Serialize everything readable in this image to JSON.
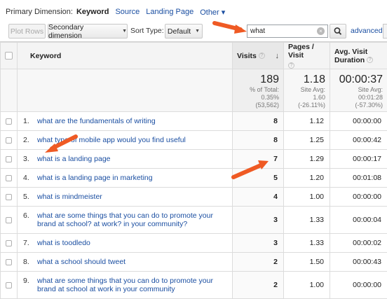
{
  "primary": {
    "label": "Primary Dimension:",
    "active": "Keyword",
    "links": [
      "Source",
      "Landing Page"
    ],
    "other": "Other ▾"
  },
  "toolbar": {
    "plot_rows": "Plot Rows",
    "secondary_dimension": "Secondary dimension",
    "sort_type_label": "Sort Type:",
    "sort_value": "Default",
    "search_value": "what",
    "advanced": "advanced"
  },
  "columns": {
    "keyword": "Keyword",
    "visits": "Visits",
    "pages_visit": "Pages / Visit",
    "avg_duration_line1": "Avg. Visit",
    "avg_duration_line2": "Duration"
  },
  "totals": {
    "visits_value": "189",
    "visits_sub1": "% of Total:",
    "visits_sub2": "0.35%",
    "visits_sub3": "(53,562)",
    "pages_value": "1.18",
    "pages_sub1": "Site Avg:",
    "pages_sub2": "1.60",
    "pages_sub3": "(-26.11%)",
    "dur_value": "00:00:37",
    "dur_sub1": "Site Avg:",
    "dur_sub2": "00:01:28",
    "dur_sub3": "(-57.30%)"
  },
  "rows": [
    {
      "rank": "1.",
      "keyword": "what are the fundamentals of writing",
      "visits": "8",
      "pages": "1.12",
      "duration": "00:00:00"
    },
    {
      "rank": "2.",
      "keyword": "what type of mobile app would you find useful",
      "visits": "8",
      "pages": "1.25",
      "duration": "00:00:42"
    },
    {
      "rank": "3.",
      "keyword": "what is a landing page",
      "visits": "7",
      "pages": "1.29",
      "duration": "00:00:17"
    },
    {
      "rank": "4.",
      "keyword": "what is a landing page in marketing",
      "visits": "5",
      "pages": "1.20",
      "duration": "00:01:08"
    },
    {
      "rank": "5.",
      "keyword": "what is mindmeister",
      "visits": "4",
      "pages": "1.00",
      "duration": "00:00:00"
    },
    {
      "rank": "6.",
      "keyword": "what are some things that you can do to promote your brand at school? at work? in your community?",
      "visits": "3",
      "pages": "1.33",
      "duration": "00:00:04"
    },
    {
      "rank": "7.",
      "keyword": "what is toodledo",
      "visits": "3",
      "pages": "1.33",
      "duration": "00:00:02"
    },
    {
      "rank": "8.",
      "keyword": "what a school should tweet",
      "visits": "2",
      "pages": "1.50",
      "duration": "00:00:43"
    },
    {
      "rank": "9.",
      "keyword": "what are some things that you can do to promote your brand at school at work in your community",
      "visits": "2",
      "pages": "1.00",
      "duration": "00:00:00"
    }
  ],
  "colors": {
    "link": "#1a4ea1",
    "annotation_arrow": "#ef5a24"
  }
}
